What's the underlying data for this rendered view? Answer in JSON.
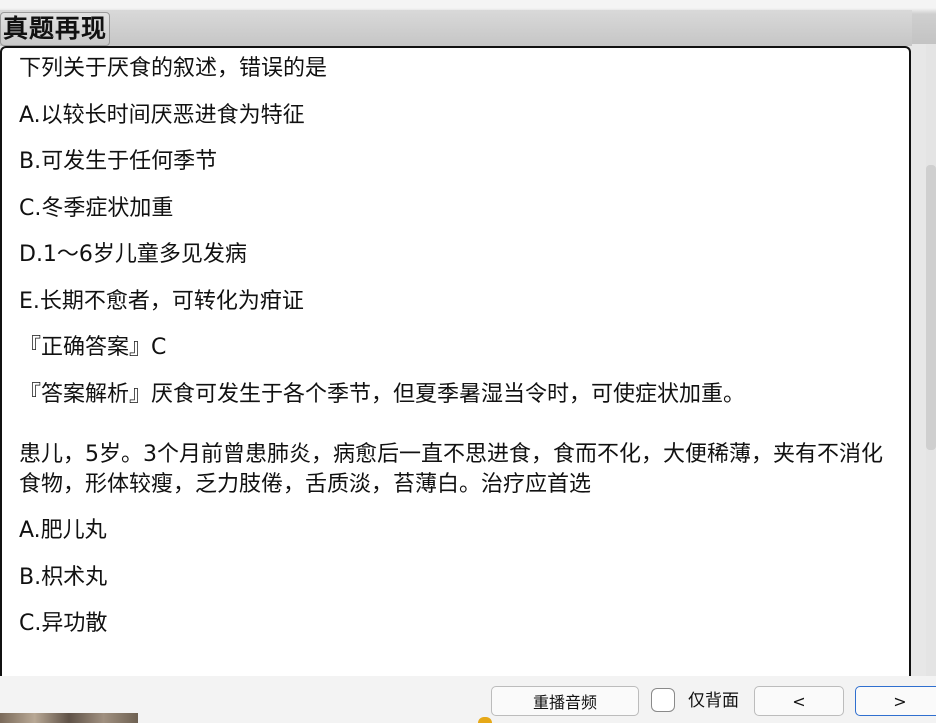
{
  "header": {
    "title": "真题再现"
  },
  "content": {
    "q1": {
      "stem": "下列关于厌食的叙述，错误的是",
      "options": [
        "A.以较长时间厌恶进食为特征",
        "B.可发生于任何季节",
        "C.冬季症状加重",
        "D.1～6岁儿童多见发病",
        "E.长期不愈者，可转化为疳证"
      ],
      "answer": "『正确答案』C",
      "analysis": "『答案解析』厌食可发生于各个季节，但夏季暑湿当令时，可使症状加重。"
    },
    "q2": {
      "stem": "患儿，5岁。3个月前曾患肺炎，病愈后一直不思进食，食而不化，大便稀薄，夹有不消化食物，形体较瘦，乏力肢倦，舌质淡，苔薄白。治疗应首选",
      "options": [
        "A.肥儿丸",
        "B.枳术丸",
        "C.异功散"
      ]
    }
  },
  "toolbar": {
    "replay_label": "重播音频",
    "back_only_label": "仅背面",
    "prev_label": "<",
    "next_label": ">"
  }
}
